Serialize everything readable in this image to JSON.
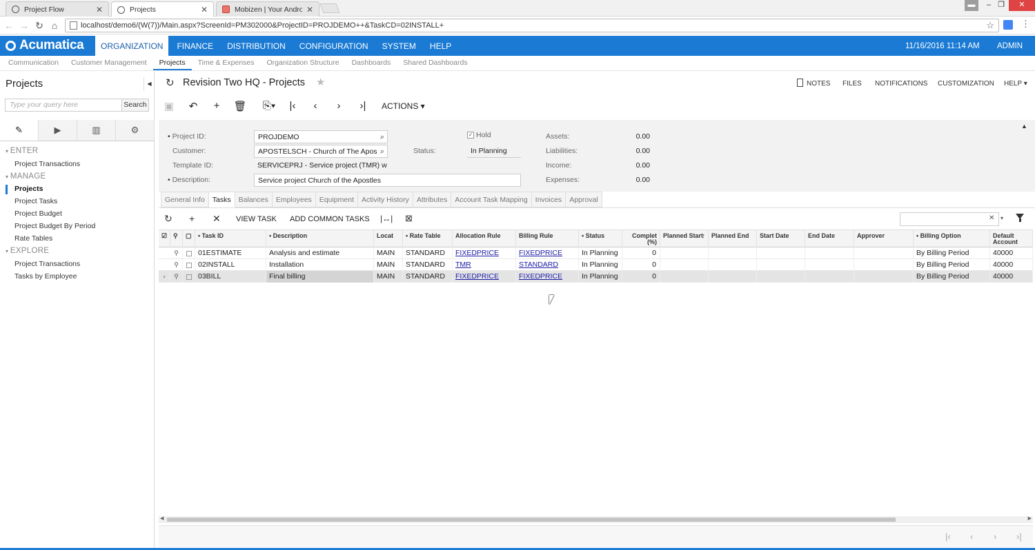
{
  "browser": {
    "tabs": [
      {
        "label": "Project Flow",
        "icon": "globe-icon"
      },
      {
        "label": "Projects",
        "icon": "globe-icon"
      },
      {
        "label": "Mobizen | Your Android",
        "icon": "mobizen-icon"
      }
    ],
    "url": "localhost/demo6/(W(7))/Main.aspx?ScreenId=PM302000&ProjectID=PROJDEMO++&TaskCD=02INSTALL+"
  },
  "app": {
    "logo": "Acumatica",
    "nav": [
      "ORGANIZATION",
      "FINANCE",
      "DISTRIBUTION",
      "CONFIGURATION",
      "SYSTEM",
      "HELP"
    ],
    "datetime": "11/16/2016  11:14 AM",
    "user": "ADMIN",
    "subnav": [
      "Communication",
      "Customer Management",
      "Projects",
      "Time & Expenses",
      "Organization Structure",
      "Dashboards",
      "Shared Dashboards"
    ]
  },
  "sidebar": {
    "title": "Projects",
    "search_placeholder": "Type your query here",
    "search_button": "Search",
    "sections": [
      {
        "label": "ENTER",
        "items": [
          "Project Transactions"
        ]
      },
      {
        "label": "MANAGE",
        "items": [
          "Projects",
          "Project Tasks",
          "Project Budget",
          "Project Budget By Period",
          "Rate Tables"
        ]
      },
      {
        "label": "EXPLORE",
        "items": [
          "Project Transactions",
          "Tasks by Employee"
        ]
      }
    ]
  },
  "page": {
    "title": "Revision Two HQ  -  Projects",
    "links": [
      "NOTES",
      "FILES",
      "NOTIFICATIONS",
      "CUSTOMIZATION",
      "HELP"
    ],
    "actions_label": "ACTIONS"
  },
  "form": {
    "project_id_label": "Project ID:",
    "project_id": "PROJDEMO",
    "customer_label": "Customer:",
    "customer": "APOSTELSCH - Church of The Apos",
    "template_label": "Template ID:",
    "template": "SERVICEPRJ - Service project (TMR) w",
    "description_label": "Description:",
    "description": "Service project Church of the Apostles",
    "hold_label": "Hold",
    "status_label": "Status:",
    "status": "In Planning",
    "assets_label": "Assets:",
    "assets": "0.00",
    "liabilities_label": "Liabilities:",
    "liabilities": "0.00",
    "income_label": "Income:",
    "income": "0.00",
    "expenses_label": "Expenses:",
    "expenses": "0.00"
  },
  "tabs": [
    "General Info",
    "Tasks",
    "Balances",
    "Employees",
    "Equipment",
    "Activity History",
    "Attributes",
    "Account Task Mapping",
    "Invoices",
    "Approval"
  ],
  "grid_toolbar": {
    "view_task": "VIEW TASK",
    "add_common": "ADD COMMON TASKS"
  },
  "grid": {
    "headers": {
      "task_id": "Task ID",
      "description": "Description",
      "location": "Locat",
      "rate_table": "Rate Table",
      "allocation_rule": "Allocation Rule",
      "billing_rule": "Billing Rule",
      "status": "Status",
      "completed": "Complet (%)",
      "planned_start": "Planned Start",
      "planned_end": "Planned End",
      "start_date": "Start Date",
      "end_date": "End Date",
      "approver": "Approver",
      "billing_option": "Billing Option",
      "default_account": "Default Account"
    },
    "rows": [
      {
        "task_id": "01ESTIMATE",
        "description": "Analysis and estimate",
        "location": "MAIN",
        "rate_table": "STANDARD",
        "allocation_rule": "FIXEDPRICE",
        "billing_rule": "FIXEDPRICE",
        "status": "In Planning",
        "completed": "0",
        "billing_option": "By Billing Period",
        "default_account": "40000"
      },
      {
        "task_id": "02INSTALL",
        "description": "Installation",
        "location": "MAIN",
        "rate_table": "STANDARD",
        "allocation_rule": "TMR",
        "billing_rule": "STANDARD",
        "status": "In Planning",
        "completed": "0",
        "billing_option": "By Billing Period",
        "default_account": "40000"
      },
      {
        "task_id": "03BILL",
        "description": "Final billing",
        "location": "MAIN",
        "rate_table": "STANDARD",
        "allocation_rule": "FIXEDPRICE",
        "billing_rule": "FIXEDPRICE",
        "status": "In Planning",
        "completed": "0",
        "billing_option": "By Billing Period",
        "default_account": "40000"
      }
    ]
  },
  "colors": {
    "brand": "#1a7ad4",
    "link": "#1a1aa6"
  }
}
